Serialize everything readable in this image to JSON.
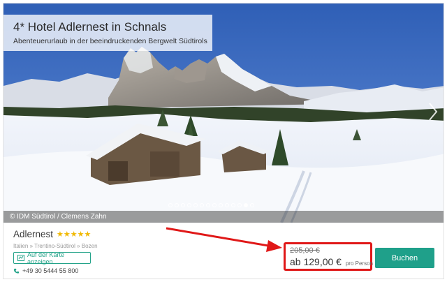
{
  "hero": {
    "title": "4* Hotel Adlernest in Schnals",
    "subtitle": "Abenteuerurlaub in der beeindruckenden Bergwelt Südtirols",
    "credit": "© IDM Südtirol / Clemens Zahn",
    "slide_count": 14,
    "active_slide": 13
  },
  "hotel": {
    "name": "Adlernest",
    "stars": "★★★★★",
    "star_rating": 4,
    "breadcrumb": "Italien » Trentino-Südtirol » Bozen",
    "map_label": "Auf der Karte anzeigen",
    "phone": "+49 30 5444 55 800"
  },
  "price": {
    "old": "205,00 €",
    "new": "ab 129,00 €",
    "per": "pro Person"
  },
  "actions": {
    "book_label": "Buchen"
  },
  "colors": {
    "accent": "#1fa08a",
    "highlight": "#e01818",
    "star": "#f0b800"
  },
  "icons": [
    "chevron-right-icon",
    "map-icon",
    "phone-icon",
    "star-icon"
  ]
}
